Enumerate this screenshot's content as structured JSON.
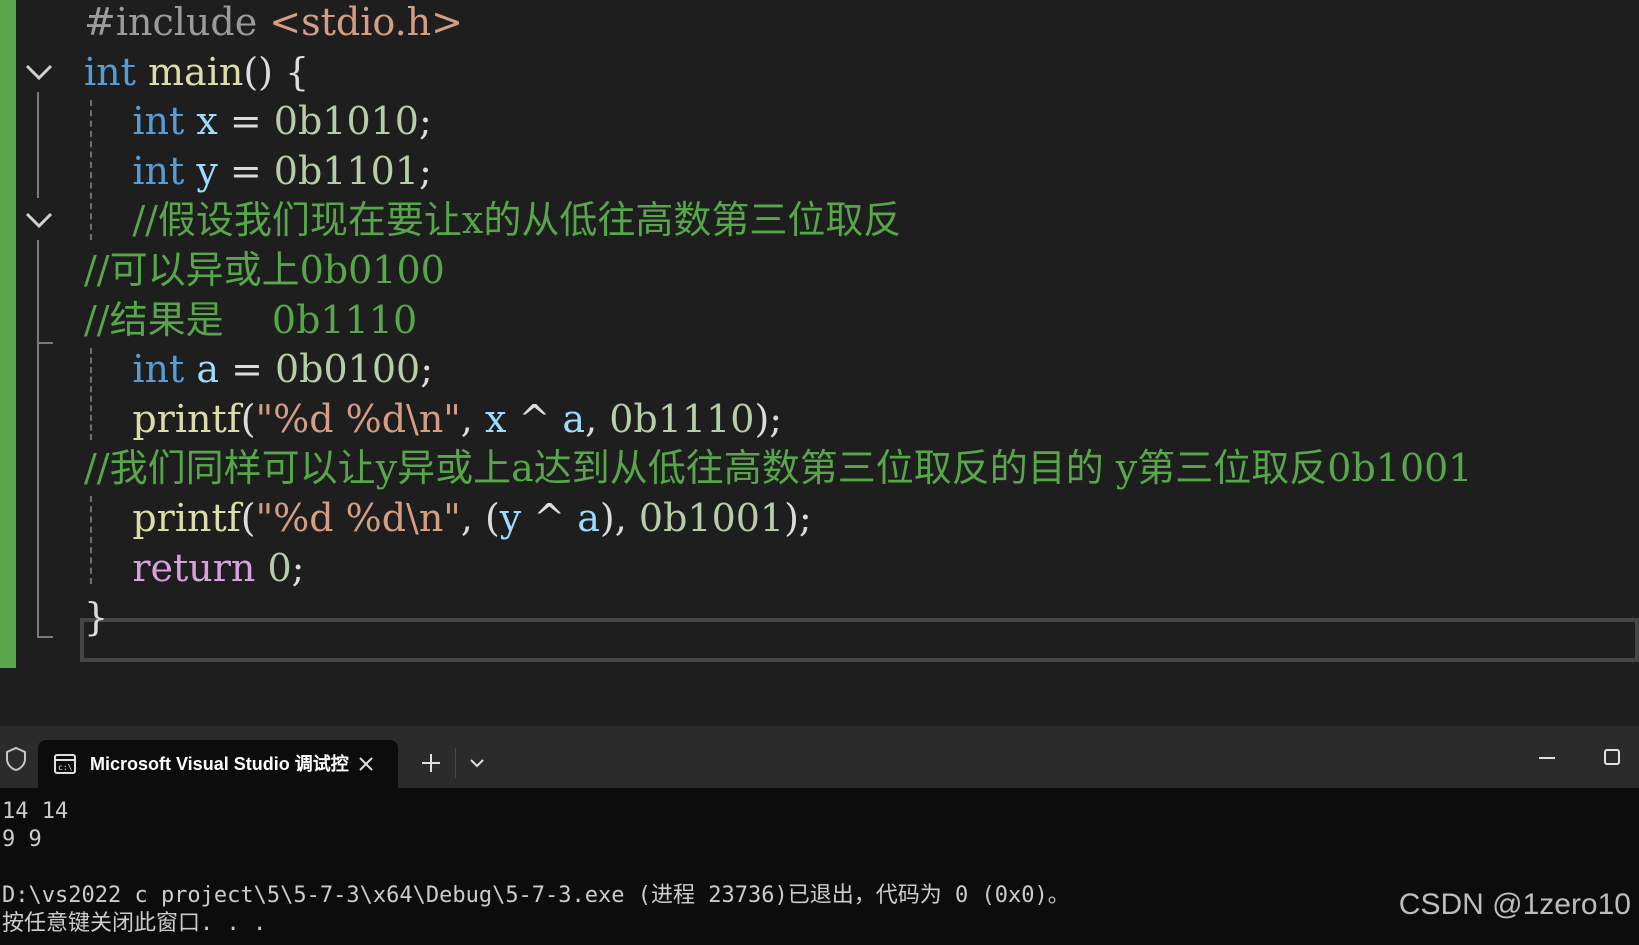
{
  "editor": {
    "lines": [
      {
        "tokens": [
          {
            "t": "#include ",
            "c": "pp"
          },
          {
            "t": "<stdio.h>",
            "c": "inc"
          }
        ]
      },
      {
        "tokens": [
          {
            "t": "int",
            "c": "kw"
          },
          {
            "t": " ",
            "c": ""
          },
          {
            "t": "main",
            "c": "fn"
          },
          {
            "t": "() {",
            "c": ""
          }
        ]
      },
      {
        "tokens": [
          {
            "t": "    ",
            "c": ""
          },
          {
            "t": "int",
            "c": "kw"
          },
          {
            "t": " ",
            "c": ""
          },
          {
            "t": "x",
            "c": "var"
          },
          {
            "t": " = ",
            "c": ""
          },
          {
            "t": "0b1010",
            "c": "num"
          },
          {
            "t": ";",
            "c": ""
          }
        ]
      },
      {
        "tokens": [
          {
            "t": "    ",
            "c": ""
          },
          {
            "t": "int",
            "c": "kw"
          },
          {
            "t": " ",
            "c": ""
          },
          {
            "t": "y",
            "c": "var"
          },
          {
            "t": " = ",
            "c": ""
          },
          {
            "t": "0b1101",
            "c": "num"
          },
          {
            "t": ";",
            "c": ""
          }
        ]
      },
      {
        "tokens": [
          {
            "t": "    ",
            "c": ""
          },
          {
            "t": "//假设我们现在要让x的从低往高数第三位取反",
            "c": "cmt"
          }
        ]
      },
      {
        "tokens": [
          {
            "t": "//可以异或上0b0100",
            "c": "cmt"
          }
        ]
      },
      {
        "tokens": [
          {
            "t": "//结果是    0b1110",
            "c": "cmt"
          }
        ]
      },
      {
        "tokens": [
          {
            "t": "    ",
            "c": ""
          },
          {
            "t": "int",
            "c": "kw"
          },
          {
            "t": " ",
            "c": ""
          },
          {
            "t": "a",
            "c": "var"
          },
          {
            "t": " = ",
            "c": ""
          },
          {
            "t": "0b0100",
            "c": "num"
          },
          {
            "t": ";",
            "c": ""
          }
        ]
      },
      {
        "tokens": [
          {
            "t": "    ",
            "c": ""
          },
          {
            "t": "printf",
            "c": "fn"
          },
          {
            "t": "(",
            "c": ""
          },
          {
            "t": "\"%d %d\\n\"",
            "c": "str"
          },
          {
            "t": ", ",
            "c": ""
          },
          {
            "t": "x",
            "c": "var"
          },
          {
            "t": " ^ ",
            "c": ""
          },
          {
            "t": "a",
            "c": "var"
          },
          {
            "t": ", ",
            "c": ""
          },
          {
            "t": "0b1110",
            "c": "num"
          },
          {
            "t": ");",
            "c": ""
          }
        ]
      },
      {
        "tokens": [
          {
            "t": "//我们同样可以让y异或上a达到从低往高数第三位取反的目的 y第三位取反0b1001",
            "c": "cmt"
          }
        ]
      },
      {
        "tokens": [
          {
            "t": "    ",
            "c": ""
          },
          {
            "t": "printf",
            "c": "fn"
          },
          {
            "t": "(",
            "c": ""
          },
          {
            "t": "\"%d %d\\n\"",
            "c": "str"
          },
          {
            "t": ", (",
            "c": ""
          },
          {
            "t": "y",
            "c": "var"
          },
          {
            "t": " ^ ",
            "c": ""
          },
          {
            "t": "a",
            "c": "var"
          },
          {
            "t": "), ",
            "c": ""
          },
          {
            "t": "0b1001",
            "c": "num"
          },
          {
            "t": ");",
            "c": ""
          }
        ]
      },
      {
        "tokens": [
          {
            "t": "    ",
            "c": ""
          },
          {
            "t": "return",
            "c": "ctl"
          },
          {
            "t": " ",
            "c": ""
          },
          {
            "t": "0",
            "c": "num"
          },
          {
            "t": ";",
            "c": ""
          }
        ]
      },
      {
        "tokens": [
          {
            "t": "}",
            "c": ""
          }
        ]
      }
    ]
  },
  "console": {
    "tab_title": "Microsoft Visual Studio 调试控",
    "icons": {
      "shield": "shield-icon",
      "terminal": "terminal-icon",
      "close": "close-icon",
      "new_tab": "plus-icon",
      "dropdown": "chevron-down-icon",
      "minimize": "minimize-icon",
      "maximize": "maximize-icon"
    },
    "output": [
      "14 14",
      "9 9",
      "",
      "D:\\vs2022 c project\\5\\5-7-3\\x64\\Debug\\5-7-3.exe (进程 23736)已退出，代码为 0 (0x0)。",
      "按任意键关闭此窗口. . ."
    ]
  },
  "watermark": "CSDN @1zero10",
  "colors": {
    "keyword": "#569cd6",
    "control": "#d8a0df",
    "function": "#dcdcaa",
    "variable": "#9cdcfe",
    "string": "#d69d85",
    "number": "#b5cea8",
    "comment": "#57a64a",
    "change_bar": "#57a64a"
  }
}
